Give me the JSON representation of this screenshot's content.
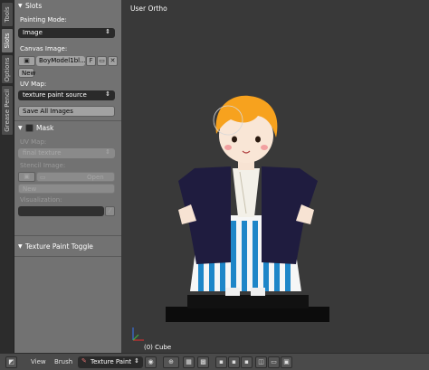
{
  "tabs": [
    {
      "label": "Tools",
      "active": false
    },
    {
      "label": "Slots",
      "active": true
    },
    {
      "label": "Options",
      "active": false
    },
    {
      "label": "Grease Pencil",
      "active": false
    }
  ],
  "slots_panel": {
    "title": "Slots",
    "painting_mode_label": "Painting Mode:",
    "painting_mode_value": "Image",
    "canvas_image_label": "Canvas Image:",
    "canvas_image_name": "BoyModel1bl...",
    "fake_user_label": "F",
    "new_button": "New",
    "uv_map_label": "UV Map:",
    "uv_map_value": "texture paint source",
    "save_all_button": "Save All Images"
  },
  "mask_panel": {
    "title": "Mask",
    "checked": false,
    "uv_map_label": "UV Map:",
    "uv_map_value": "final texture",
    "stencil_label": "Stencil Image:",
    "open_button": "Open",
    "new_button": "New",
    "visualization_label": "Visualization:"
  },
  "toggle_panel": {
    "title": "Texture Paint Toggle"
  },
  "viewport": {
    "title": "User Ortho",
    "object_label": "(0) Cube"
  },
  "header": {
    "view_menu": "View",
    "brush_menu": "Brush",
    "mode": "Texture Paint"
  },
  "colors": {
    "panel_bg": "#727272",
    "viewport_bg": "#393939",
    "hair": "#f7a21e",
    "jacket": "#1f1c3f",
    "stripe_blue": "#1e86c8"
  }
}
